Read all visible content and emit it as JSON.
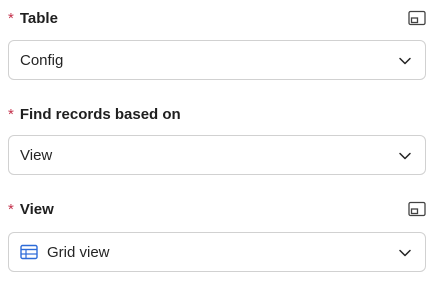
{
  "fields": [
    {
      "required_marker": "*",
      "label": "Table",
      "value": "Config",
      "has_expand_icon": true,
      "value_icon": null
    },
    {
      "required_marker": "*",
      "label": "Find records based on",
      "value": "View",
      "has_expand_icon": false,
      "value_icon": null
    },
    {
      "required_marker": "*",
      "label": "View",
      "value": "Grid view",
      "has_expand_icon": true,
      "value_icon": "grid-view-icon"
    }
  ],
  "colors": {
    "required": "#c4314b",
    "border": "#d1d1d1",
    "accent": "#2d6bd8",
    "text": "#242424"
  },
  "icons": {
    "expand": "expand-panel-icon",
    "dropdown": "chevron-down-icon"
  }
}
